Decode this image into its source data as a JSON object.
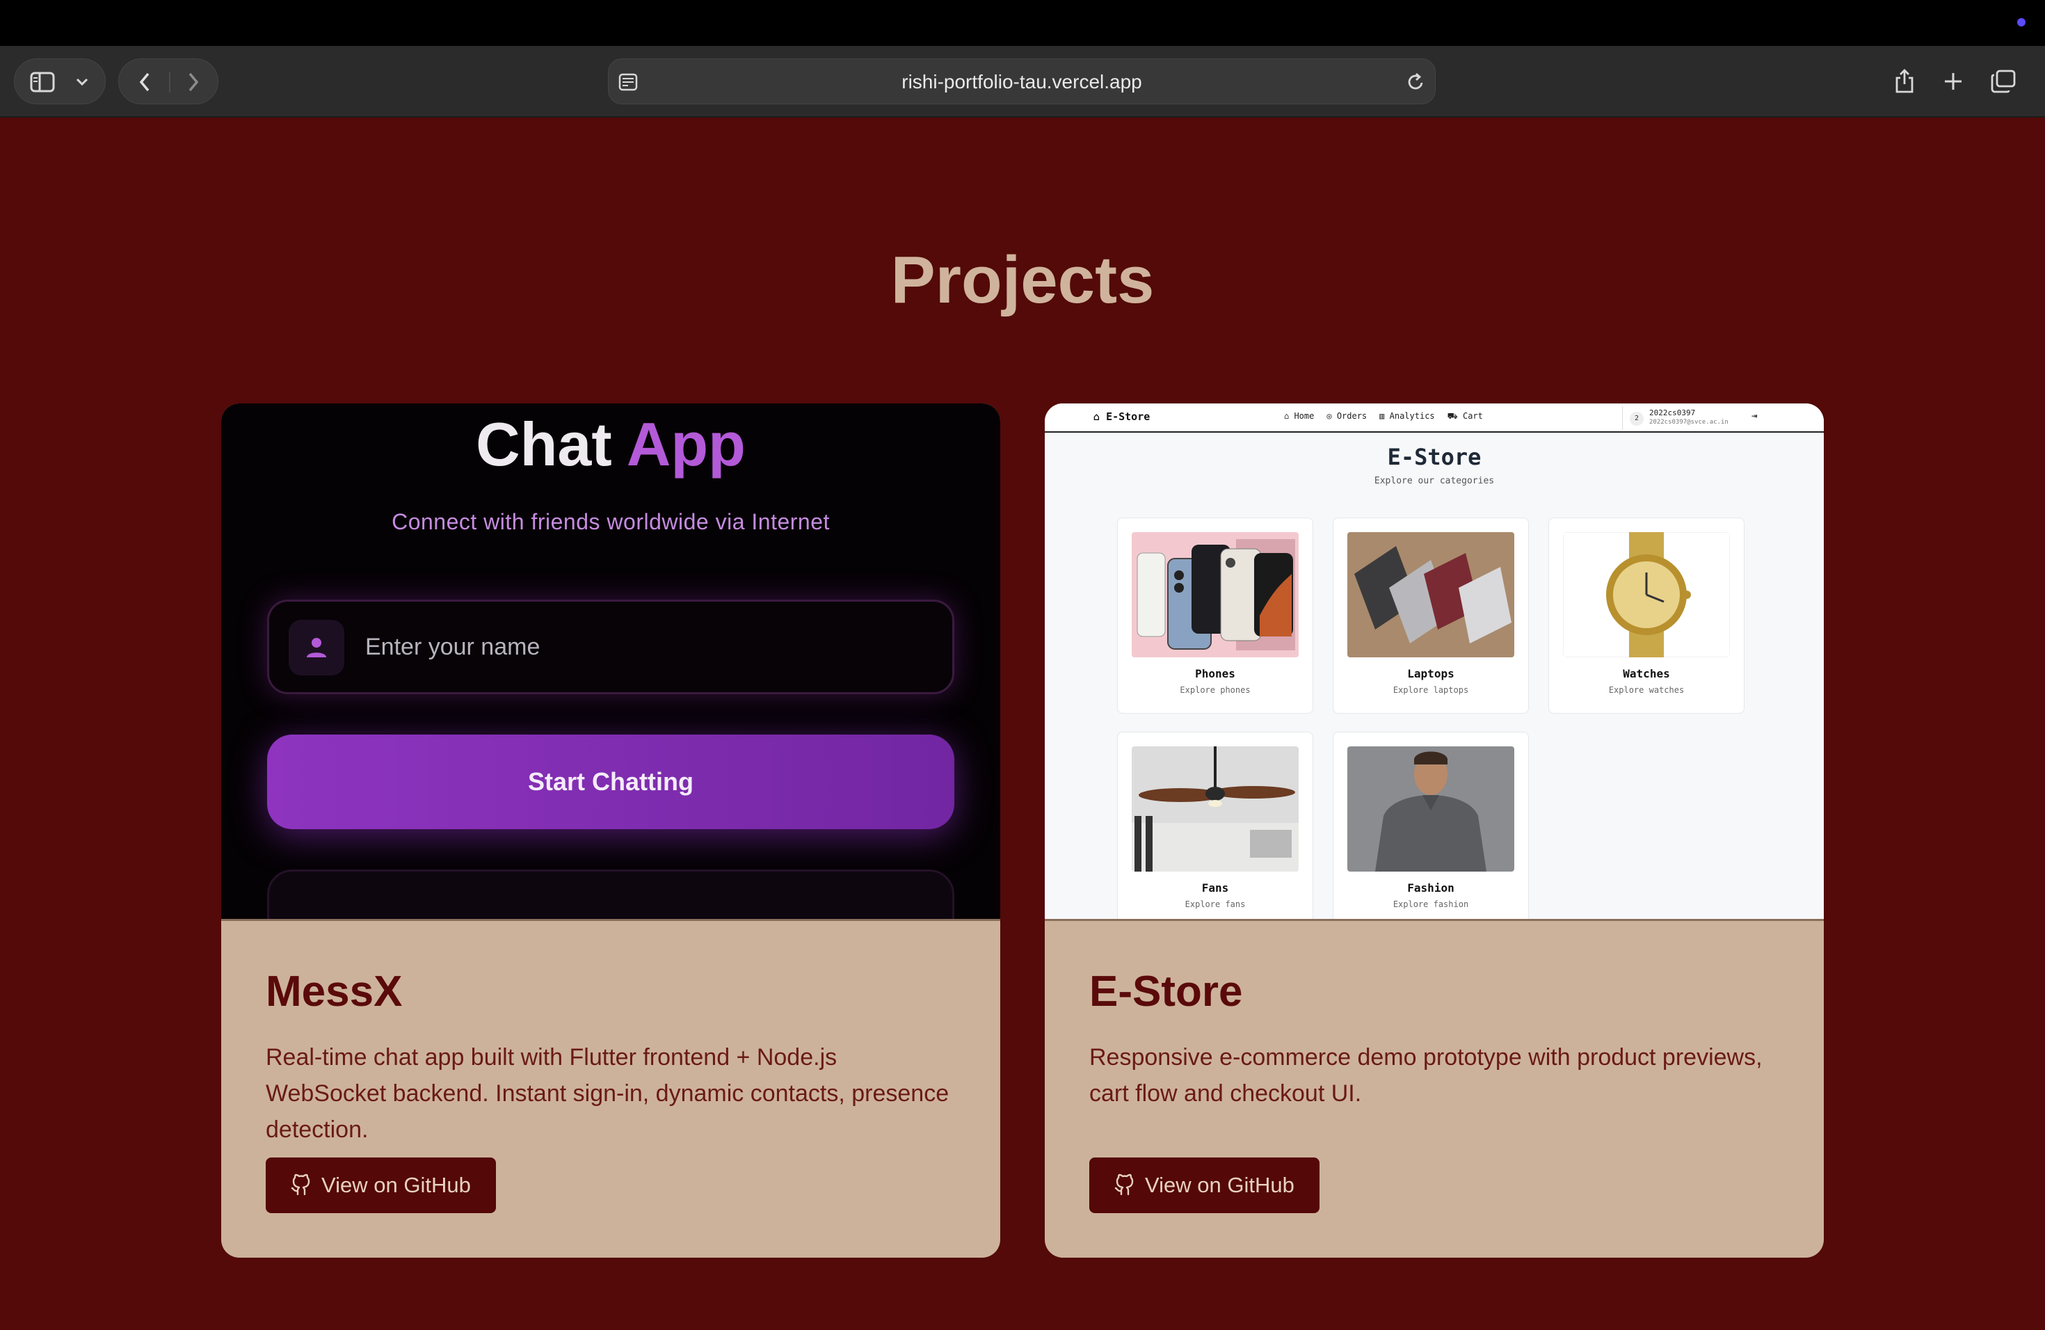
{
  "browser": {
    "url": "rishi-portfolio-tau.vercel.app"
  },
  "page": {
    "section_title": "Projects",
    "accent_color": "#530a09",
    "card_color": "#cdb29b"
  },
  "projects": [
    {
      "title": "MessX",
      "description": "Real-time chat app built with Flutter frontend + Node.js WebSocket backend. Instant sign-in, dynamic contacts, presence detection.",
      "button_label": "View on GitHub",
      "preview": {
        "title_part1": "Chat",
        "title_part2": "App",
        "subtitle": "Connect with friends worldwide via Internet",
        "input_placeholder": "Enter your name",
        "button_label": "Start Chatting"
      }
    },
    {
      "title": "E-Store",
      "description": "Responsive e-commerce demo prototype with product previews, cart flow and checkout UI.",
      "button_label": "View on GitHub",
      "preview": {
        "brand": "E-Store",
        "nav": [
          "Home",
          "Orders",
          "Analytics",
          "Cart"
        ],
        "user_initial": "2",
        "user_id": "2022cs0397",
        "user_email": "2022cs0397@svce.ac.in",
        "heading": "E-Store",
        "subheading": "Explore our categories",
        "categories": [
          {
            "name": "Phones",
            "caption": "Explore phones"
          },
          {
            "name": "Laptops",
            "caption": "Explore laptops"
          },
          {
            "name": "Watches",
            "caption": "Explore watches"
          },
          {
            "name": "Fans",
            "caption": "Explore fans"
          },
          {
            "name": "Fashion",
            "caption": "Explore fashion"
          }
        ]
      }
    }
  ]
}
